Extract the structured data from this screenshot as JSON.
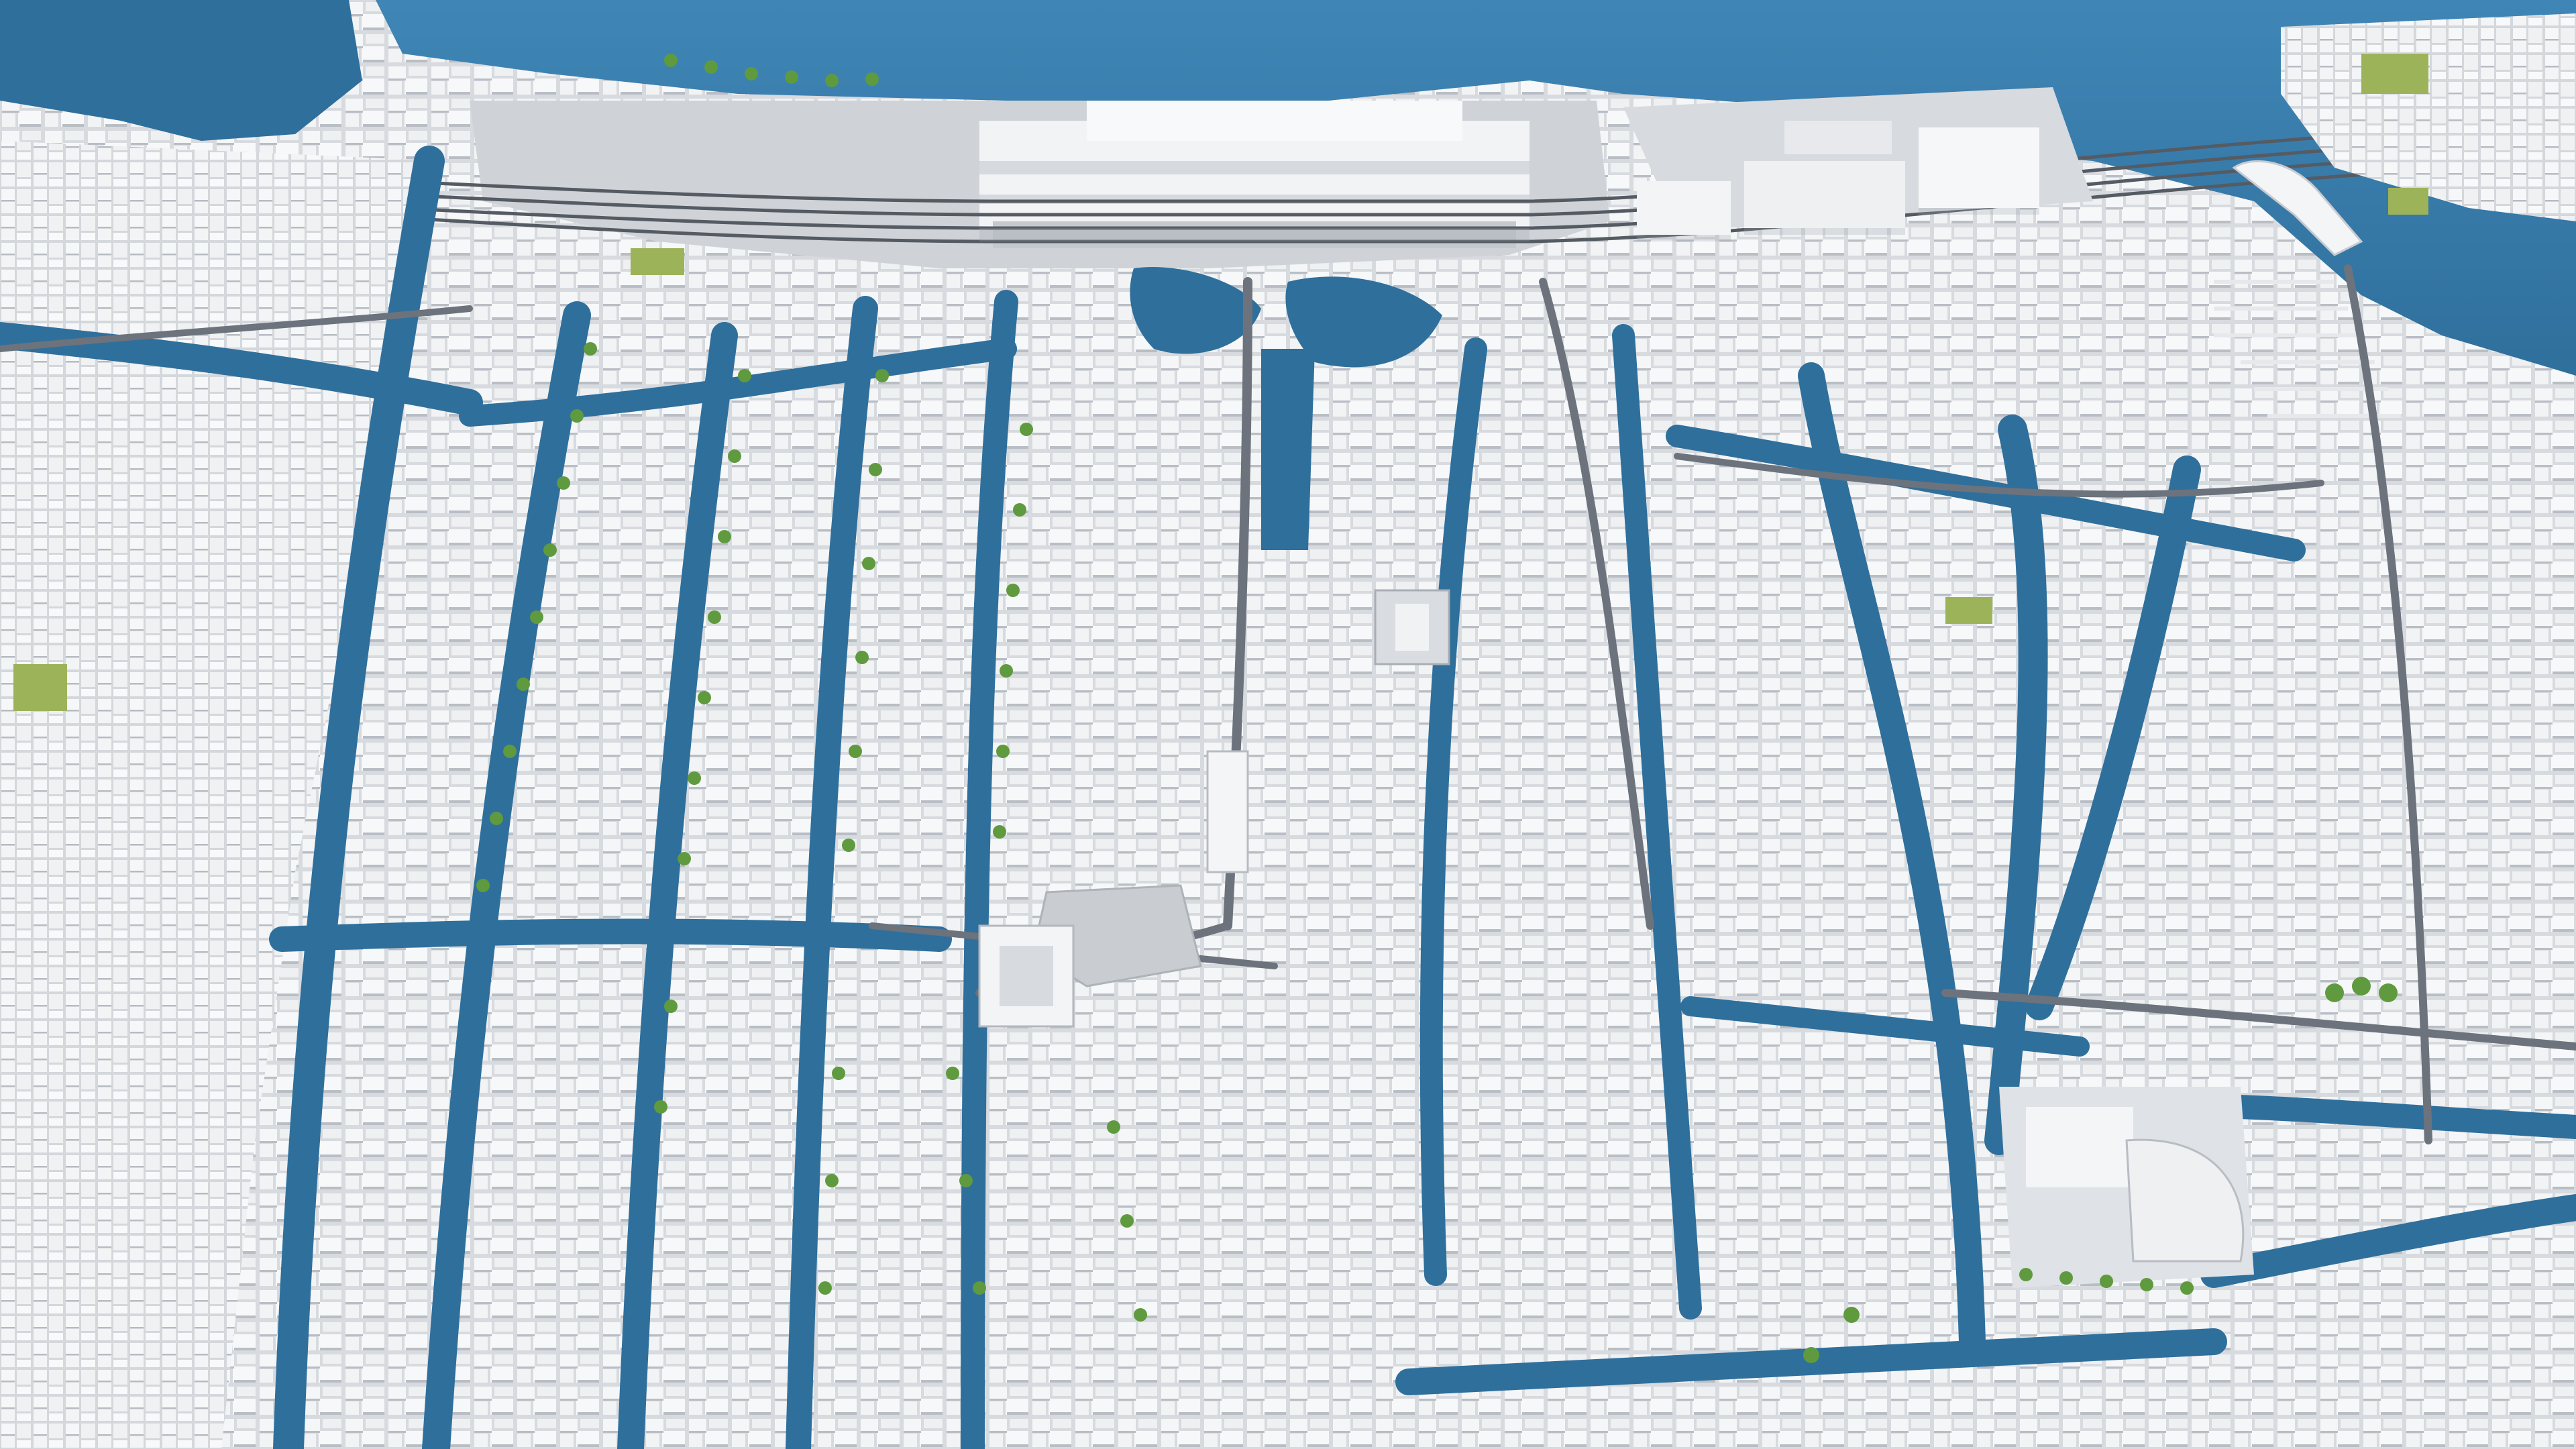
{
  "map": {
    "style": "3d-city-model-aerial",
    "colors": {
      "water": "#2f6f9c",
      "water_highlight": "#3f86b6",
      "ground": "#e3e6ea",
      "building_roof": "#f4f5f6",
      "building_side": "#c9ccd1",
      "building_shadow": "#9aa2ac",
      "road": "#6c737c",
      "rail": "#555b63",
      "tree": "#5f9a3f",
      "park": "#9db35a"
    },
    "features": [
      "harbor-water",
      "central-station",
      "rail-yard",
      "canal-ring",
      "city-blocks",
      "tree-lined-canals",
      "central-square",
      "church",
      "theater-complex",
      "marina-piers",
      "cruise-ship"
    ]
  }
}
